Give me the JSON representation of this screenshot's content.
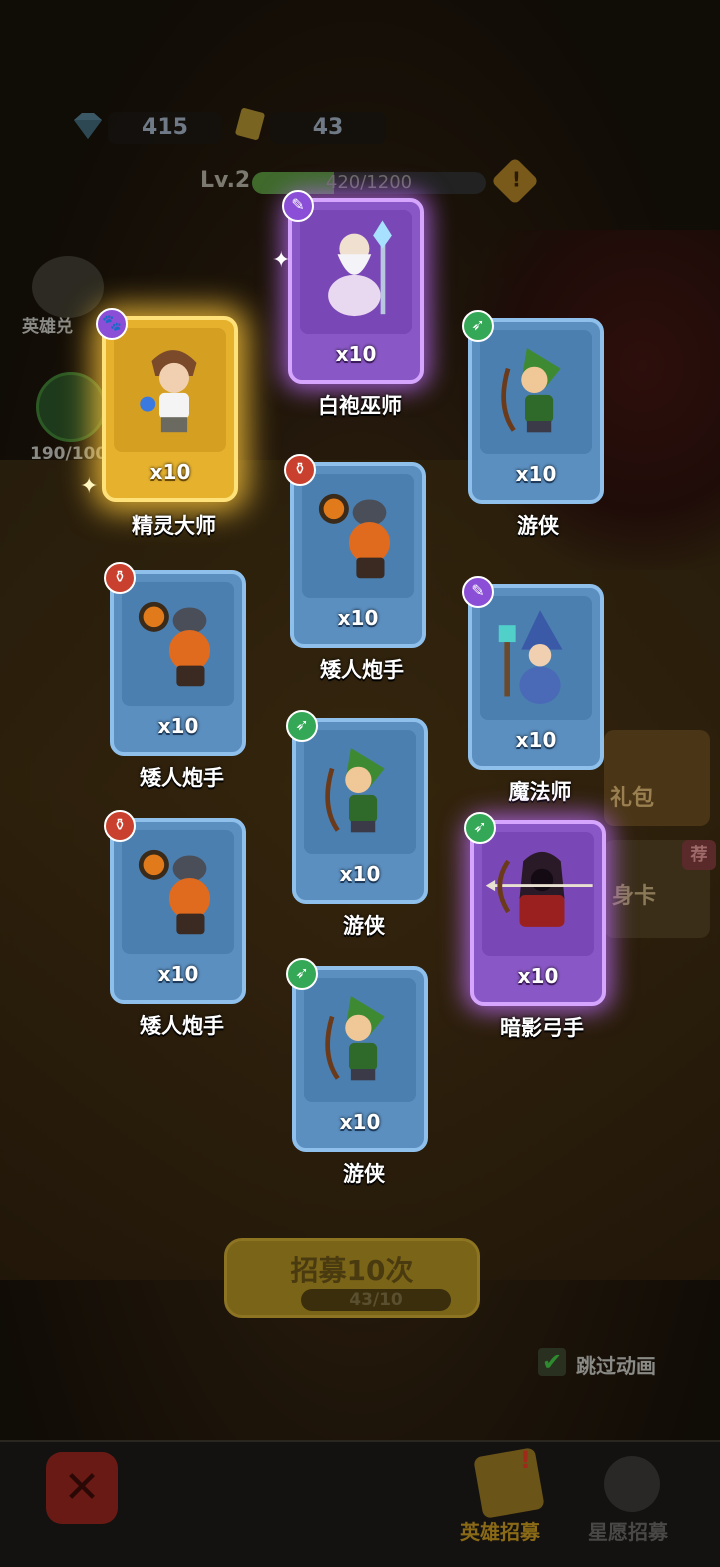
{
  "resources": {
    "gems": "415",
    "tickets": "43"
  },
  "level": {
    "label": "Lv.2",
    "xp_text": "420/1200",
    "xp_fraction": 0.35,
    "warn": "!"
  },
  "side": {
    "hero_exchange": "英雄兑",
    "star_progress": "190/100"
  },
  "cards": [
    {
      "name": "精灵大师",
      "count": "x10",
      "rarity": "gold",
      "badge": "🐾"
    },
    {
      "name": "白袍巫师",
      "count": "x10",
      "rarity": "purple",
      "badge": "✎"
    },
    {
      "name": "游侠",
      "count": "x10",
      "rarity": "blue",
      "badge": "➶"
    },
    {
      "name": "矮人炮手",
      "count": "x10",
      "rarity": "blue",
      "badge": "⚱"
    },
    {
      "name": "矮人炮手",
      "count": "x10",
      "rarity": "blue",
      "badge": "⚱"
    },
    {
      "name": "魔法师",
      "count": "x10",
      "rarity": "blue",
      "badge": "✎"
    },
    {
      "name": "游侠",
      "count": "x10",
      "rarity": "blue",
      "badge": "➶"
    },
    {
      "name": "矮人炮手",
      "count": "x10",
      "rarity": "blue",
      "badge": "⚱"
    },
    {
      "name": "暗影弓手",
      "count": "x10",
      "rarity": "purple",
      "badge": "➶"
    },
    {
      "name": "游侠",
      "count": "x10",
      "rarity": "blue",
      "badge": "➶"
    }
  ],
  "recruit": {
    "label": "招募10次",
    "cost": "43/10"
  },
  "skip": {
    "label": "跳过动画",
    "checked": "✔"
  },
  "right_panel": {
    "gift": "礼包",
    "card": "身卡",
    "tag": "荐"
  },
  "tabs": {
    "hero_recruit": "英雄招募",
    "star_recruit": "星愿招募",
    "close": "✕"
  }
}
